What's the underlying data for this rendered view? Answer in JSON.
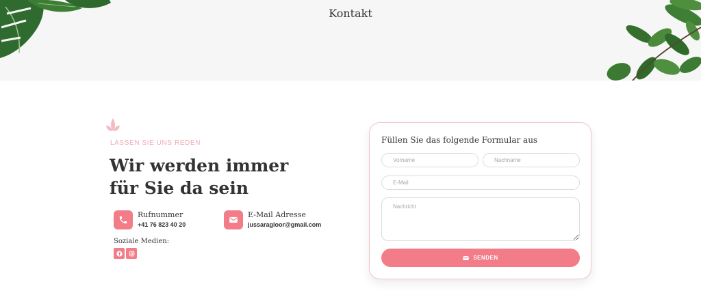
{
  "header": {
    "title": "Kontakt"
  },
  "intro": {
    "eyebrow": "LASSEN SIE UNS REDEN",
    "headline": "Wir werden immer für Sie da sein"
  },
  "contacts": {
    "phone": {
      "label": "Rufnummer",
      "value": "+41 76 823 40 20",
      "icon": "phone-icon"
    },
    "email": {
      "label": "E-Mail Adresse",
      "value": "jussaragloor@gmail.com",
      "icon": "envelope-icon"
    }
  },
  "social": {
    "label": "Soziale Medien:",
    "items": [
      {
        "name": "facebook",
        "icon": "facebook-icon"
      },
      {
        "name": "instagram",
        "icon": "instagram-icon"
      }
    ]
  },
  "form": {
    "title": "Füllen Sie das folgende Formular aus",
    "first_name_placeholder": "Vorname",
    "last_name_placeholder": "Nachname",
    "email_placeholder": "E-Mail",
    "message_placeholder": "Nachricht",
    "submit_label": "SENDEN"
  },
  "colors": {
    "accent": "#f27c88",
    "eyebrow": "#f0a9b6",
    "card_border": "#f3c3cb",
    "header_bg": "#f6f6f6"
  }
}
